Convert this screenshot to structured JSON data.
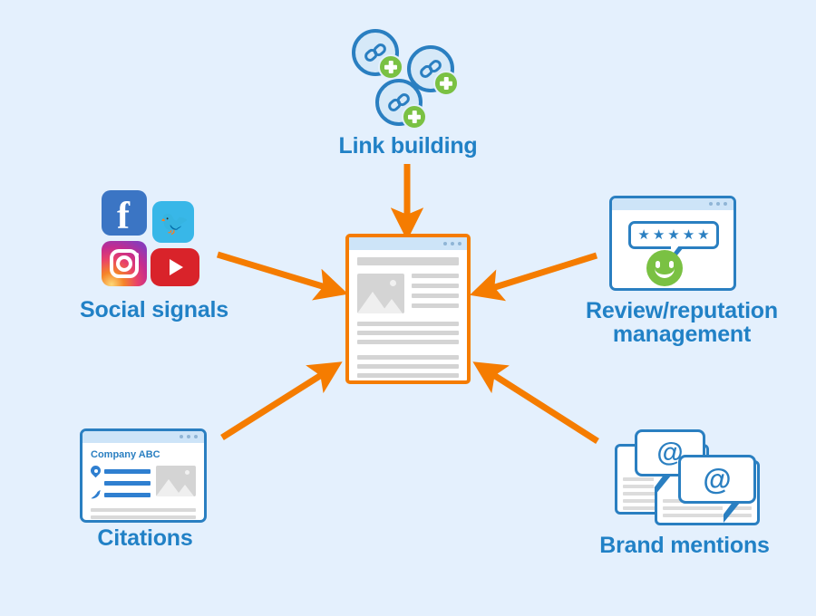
{
  "diagram": {
    "type": "hub-and-spoke",
    "background_color": "#e4f0fd",
    "accent_color": "#2181c6",
    "arrow_color": "#f57c00",
    "center": {
      "name": "website-page",
      "border_color": "#f57c00",
      "titlebar_color": "#cde4f8"
    },
    "nodes": [
      {
        "id": "link-building",
        "label": "Link building",
        "position": "top",
        "icon": "link-plus-badges-icon"
      },
      {
        "id": "social-signals",
        "label": "Social signals",
        "position": "left-top",
        "icon": "social-network-icons"
      },
      {
        "id": "review-reputation",
        "label": "Review/reputation\nmanagement",
        "position": "right-top",
        "icon": "star-review-browser-icon"
      },
      {
        "id": "citations",
        "label": "Citations",
        "position": "left-bottom",
        "icon": "business-listing-browser-icon"
      },
      {
        "id": "brand-mentions",
        "label": "Brand mentions",
        "position": "right-bottom",
        "icon": "at-speech-bubble-documents-icon"
      }
    ],
    "social_icons": [
      {
        "name": "facebook-icon",
        "glyph": "f",
        "color": "#3b75c4"
      },
      {
        "name": "twitter-icon",
        "glyph": "✈",
        "color": "#38b7e8"
      },
      {
        "name": "instagram-icon",
        "glyph": "camera",
        "color": "#c42c8f"
      },
      {
        "name": "youtube-icon",
        "glyph": "▶",
        "color": "#d9232a"
      }
    ],
    "citations_card": {
      "title": "Company ABC",
      "fields": [
        "address-line",
        "phone-line"
      ]
    },
    "review_card": {
      "stars": "★★★★★",
      "star_count": 5,
      "smiley_color": "#7ac143"
    },
    "brand_card": {
      "symbol": "@",
      "bubbles": 2
    },
    "link_building": {
      "coin_count": 3,
      "badge_symbol": "+",
      "badge_color": "#7ac143",
      "coin_color": "#2a7fc1"
    }
  }
}
